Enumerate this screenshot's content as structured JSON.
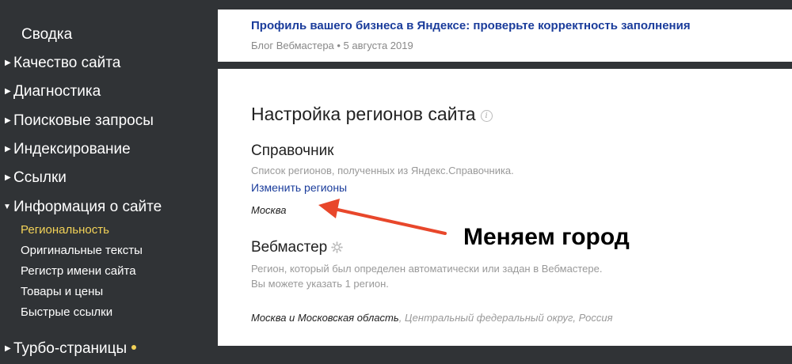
{
  "sidebar": {
    "items": [
      {
        "label": "Сводка",
        "arrow": ""
      },
      {
        "label": "Качество сайта",
        "arrow": "▶"
      },
      {
        "label": "Диагностика",
        "arrow": "▶"
      },
      {
        "label": "Поисковые запросы",
        "arrow": "▶"
      },
      {
        "label": "Индексирование",
        "arrow": "▶"
      },
      {
        "label": "Ссылки",
        "arrow": "▶"
      },
      {
        "label": "Информация о сайте",
        "arrow": "▼"
      }
    ],
    "subitems": [
      {
        "label": "Региональность",
        "active": true
      },
      {
        "label": "Оригинальные тексты"
      },
      {
        "label": "Регистр имени сайта"
      },
      {
        "label": "Товары и цены"
      },
      {
        "label": "Быстрые ссылки"
      }
    ],
    "turbo": {
      "label": "Турбо-страницы",
      "arrow": "▶"
    },
    "accent_color": "#f2d258"
  },
  "news": {
    "title": "Профиль вашего бизнеса в Яндексе: проверьте корректность заполнения",
    "meta": "Блог Вебмастера • 5 августа 2019"
  },
  "main": {
    "title": "Настройка регионов сайта",
    "directory": {
      "title": "Справочник",
      "desc": "Список регионов, полученных из Яндекс.Справочника.",
      "link": "Изменить регионы",
      "region": "Москва"
    },
    "webmaster": {
      "title": "Вебмастер",
      "desc1": "Регион, который был определен автоматически или задан в Вебмастере.",
      "desc2": "Вы можете указать 1 регион.",
      "region": "Москва и Московская область",
      "region_extra": ", Центральный федеральный округ, Россия"
    }
  },
  "annotation": {
    "text": "Меняем город",
    "color": "#e8472b"
  }
}
